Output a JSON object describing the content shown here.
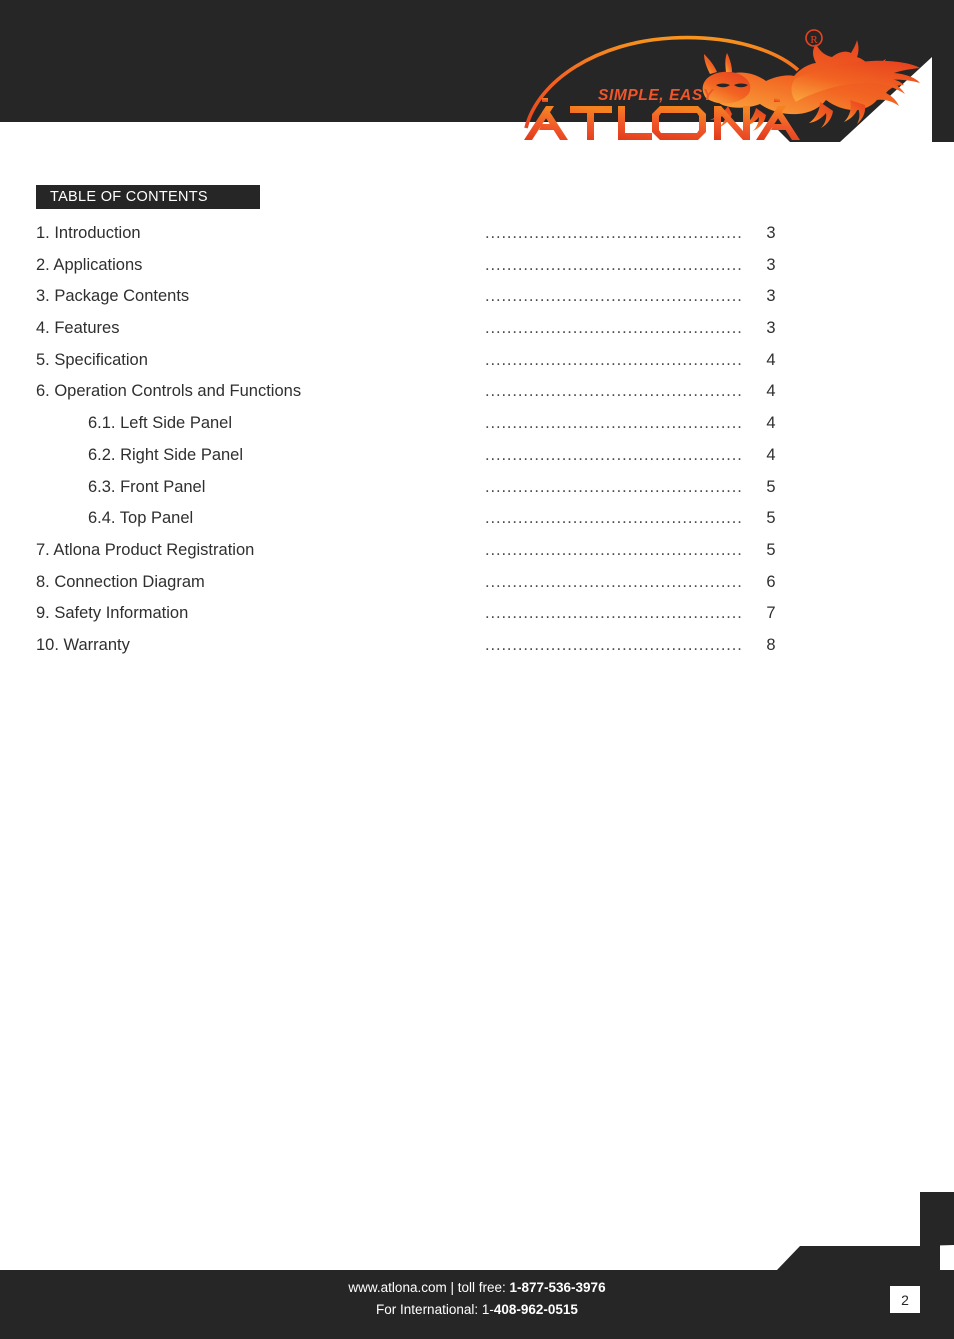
{
  "document": {
    "brand": "ATLONA",
    "tagline": "SIMPLE, EASY",
    "registered_mark": "®"
  },
  "colors": {
    "dark": "#262626",
    "brand_orange": "#ef5423",
    "brand_orange_light": "#f7941e",
    "text": "#2f2f2f",
    "white": "#ffffff"
  },
  "toc": {
    "banner_label": "TABLE OF CONTENTS",
    "leader": "...................................................",
    "entries": [
      {
        "title": "1. Introduction",
        "page": "3",
        "sub": false
      },
      {
        "title": "2. Applications",
        "page": "3",
        "sub": false
      },
      {
        "title": "3. Package Contents",
        "page": "3",
        "sub": false
      },
      {
        "title": "4. Features",
        "page": "3",
        "sub": false
      },
      {
        "title": "5. Specification",
        "page": "4",
        "sub": false
      },
      {
        "title": "6. Operation Controls and Functions",
        "page": "4",
        "sub": false
      },
      {
        "title": "6.1. Left Side Panel",
        "page": "4",
        "sub": true
      },
      {
        "title": "6.2. Right Side Panel",
        "page": "4",
        "sub": true
      },
      {
        "title": "6.3. Front Panel",
        "page": "5",
        "sub": true
      },
      {
        "title": "6.4. Top Panel",
        "page": "5",
        "sub": true
      },
      {
        "title": "7. Atlona Product Registration",
        "page": "5",
        "sub": false
      },
      {
        "title": "8. Connection Diagram",
        "page": "6",
        "sub": false
      },
      {
        "title": "9. Safety Information",
        "page": "7",
        "sub": false
      },
      {
        "title": "10. Warranty",
        "page": "8",
        "sub": false
      }
    ]
  },
  "footer": {
    "line1_prefix": "www.atlona.com | toll free: ",
    "line1_bold": "1-877-536-3976",
    "line2_prefix": "For International: 1-",
    "line2_bold": "408-962-0515",
    "page_number": "2"
  }
}
